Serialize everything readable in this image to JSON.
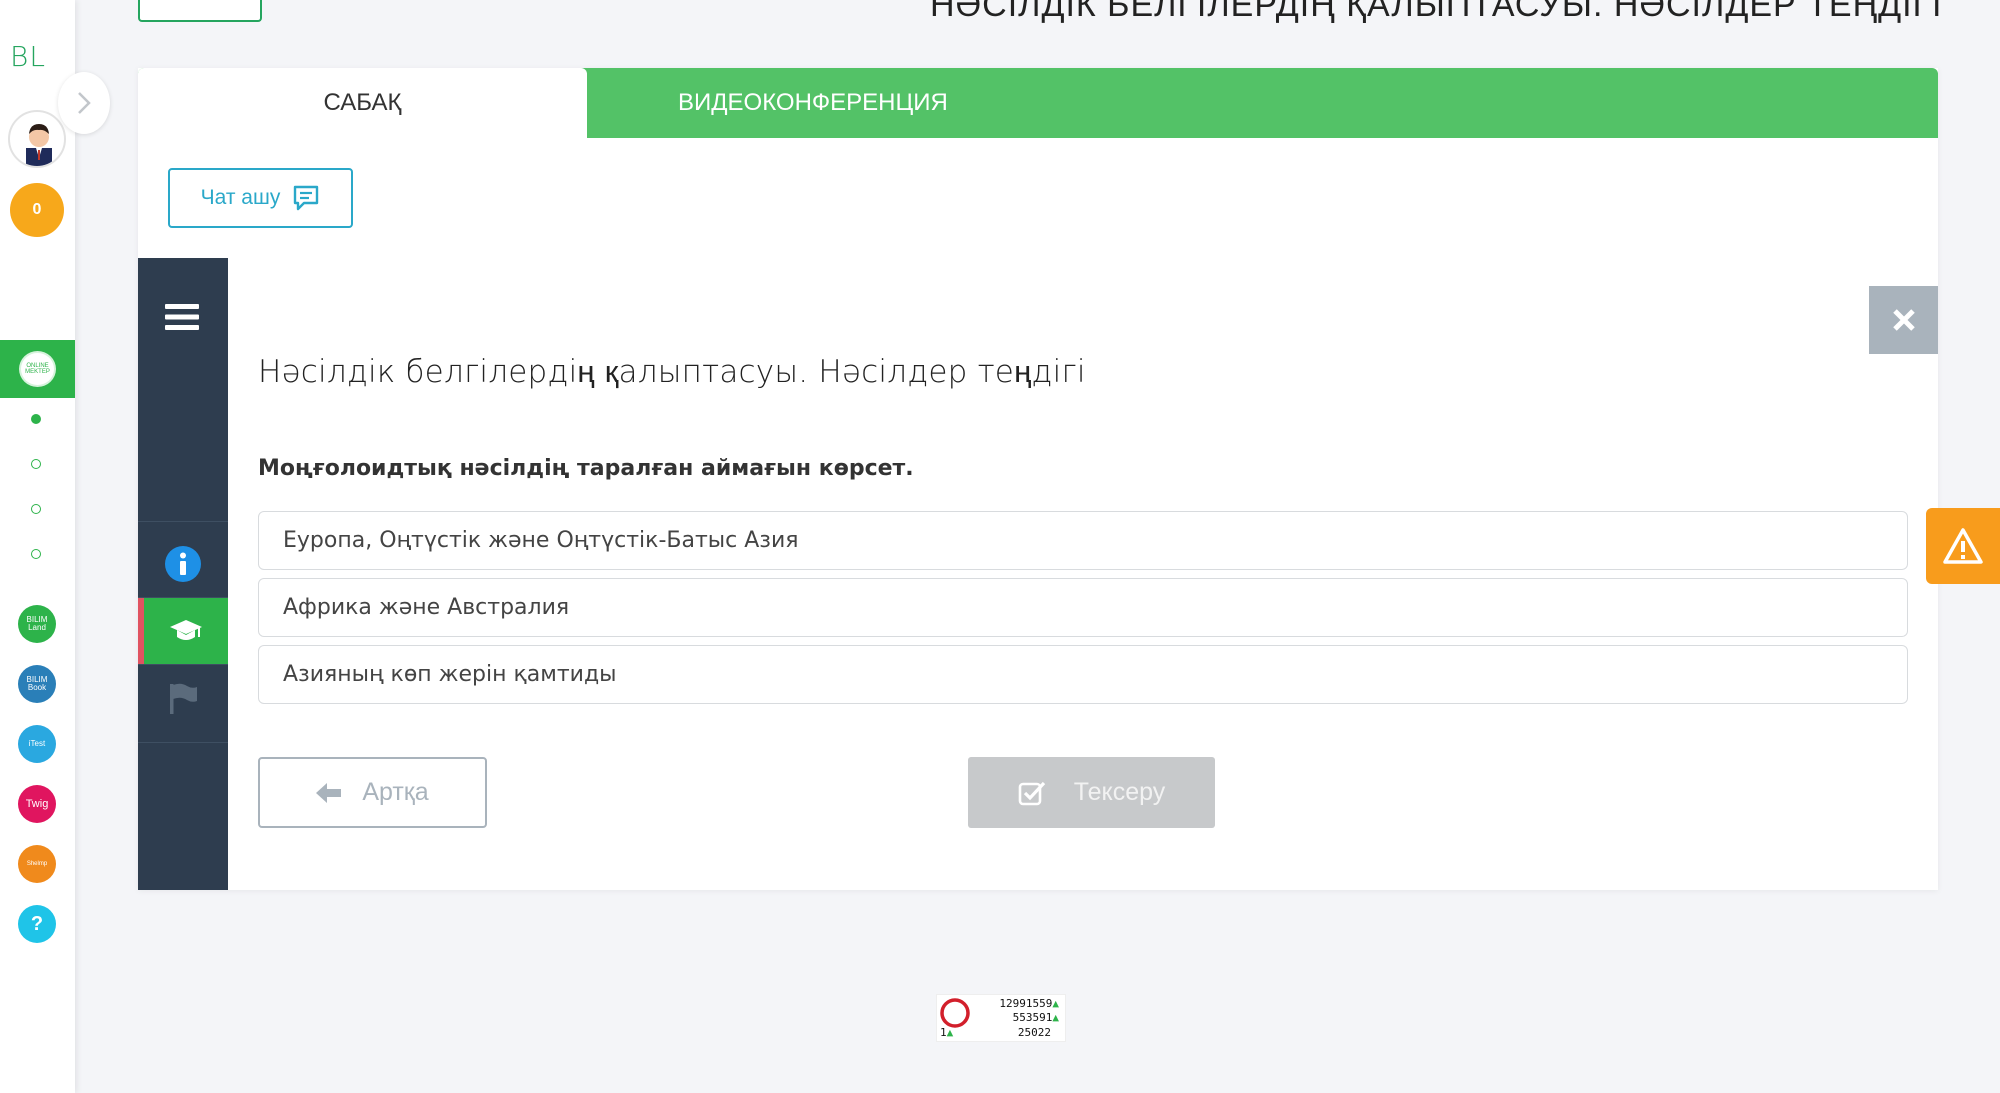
{
  "app": {
    "logo": "BL",
    "coins": "0",
    "page_heading_partial": "НӘСІЛДІК БЕЛГІЛЕРДІҢ ҚАЛЫПТАСУЫ. НӘСІЛДЕР ТЕҢДІГІ",
    "colors": {
      "accent_green": "#53c267",
      "dark_panel": "#2e3d4f",
      "info_blue": "#2aa8c9",
      "warning_orange": "#f89c1c"
    }
  },
  "sidebar": {
    "online_label": "ONLINE MEKTEP",
    "apps": [
      {
        "label": "BILIM Land",
        "color": "#2db34a"
      },
      {
        "label": "BILIM Book",
        "color": "#2a7fb8"
      },
      {
        "label": "iTest",
        "color": "#2aa8e0"
      },
      {
        "label": "Twig",
        "color": "#e0155f"
      },
      {
        "label": "Shelmp",
        "color": "#f08a1c"
      },
      {
        "label": "?",
        "color": "#1fc4e8"
      }
    ]
  },
  "tabs": {
    "lesson": "САБАҚ",
    "video": "ВИДЕОКОНФЕРЕНЦИЯ"
  },
  "chat": {
    "label": "Чат ашу"
  },
  "lesson": {
    "title": "Нәсілдік белгілердің қалыптасуы. Нәсілдер теңдігі",
    "question": "Моңғолоидтық нәсілдің таралған аймағын көрсет.",
    "options": [
      "Еуропа, Оңтүстік және Оңтүстік-Батыс Азия",
      "Африка және Австралия",
      "Азияның көп жерін қамтиды"
    ],
    "back_label": "Артқа",
    "check_label": "Тексеру"
  },
  "counter": {
    "line1": "12991559",
    "line2": "553591",
    "line3": "25022",
    "line4": "1"
  }
}
